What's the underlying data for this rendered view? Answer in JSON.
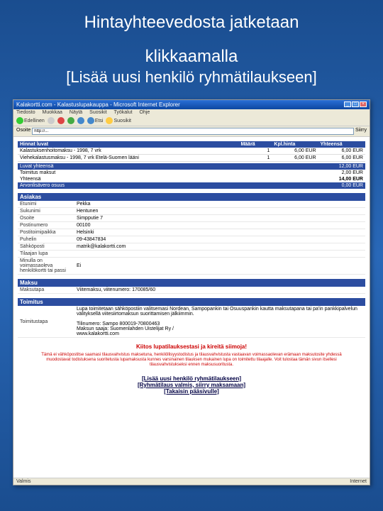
{
  "slide": {
    "title_a": "Hintayhteevedosta jatketaan",
    "title_b": "klikkaamalla",
    "subtitle": "[Lisää uusi henkilö ryhmätilaukseen]"
  },
  "window": {
    "title": "Kalakortti.com - Kalastuslupakauppa - Microsoft Internet Explorer",
    "menu": [
      "Tiedosto",
      "Muokkaa",
      "Näytä",
      "Suosikit",
      "Työkalut",
      "Ohje"
    ],
    "toolbar": {
      "back": "Edellinen",
      "search": "Etsi",
      "fav": "Suosikit"
    },
    "addr_label": "Osoite",
    "addr": "http://...",
    "go": "Siirry",
    "status": "Valmis",
    "zone": "Internet"
  },
  "price_headers": {
    "name": "Hinnat luvat",
    "qty": "Määrä",
    "unit": "Kpl.hinta",
    "total": "Yhteensä"
  },
  "price_rows": [
    {
      "name": "Kalastuksenhoitomaksu - 1998, 7 vrk",
      "qty": "1",
      "unit": "6,00 EUR",
      "total": "6,00 EUR"
    },
    {
      "name": "Viehekalastusmaksu - 1998, 7 vrk Etelä-Suomen lääni",
      "qty": "1",
      "unit": "6,00 EUR",
      "total": "6,00 EUR"
    }
  ],
  "totals": {
    "sub_l": "Luvat yhteensä",
    "sub_v": "12,00 EUR",
    "ship_l": "Toimitus maksut",
    "ship_v": "2,00 EUR",
    "tot_l": "Yhteensä",
    "tot_v": "14,00 EUR",
    "vat_l": "Arvonlisävero osuus",
    "vat_v": "0,00 EUR"
  },
  "sections": {
    "customer": "Asiakas",
    "payment": "Maksu",
    "delivery": "Toimitus"
  },
  "customer": [
    {
      "l": "Etunimi",
      "v": "Pekka"
    },
    {
      "l": "Sukunimi",
      "v": "Hentunen"
    },
    {
      "l": "Osoite",
      "v": "Simpputie 7"
    },
    {
      "l": "Postinumero",
      "v": "00100"
    },
    {
      "l": "Postitoimipaikka",
      "v": "Helsinki"
    },
    {
      "l": "Puhelin",
      "v": "09-43847834"
    },
    {
      "l": "Sähköposti",
      "v": "matrik@kalakortti.com"
    },
    {
      "l": "Tilaajan lupa",
      "v": ""
    },
    {
      "l": "Minulla on voimassaoleva henkilökortti tai passi",
      "v": "Ei"
    }
  ],
  "payment": [
    {
      "l": "Maksutapa",
      "v": "Viitemaksu, viitenumero: 170085/60"
    }
  ],
  "delivery": [
    {
      "l": "Toimitustapa",
      "v": "Lupa toimitetaan sähköpostiin valitsemasi Nordean, Sampopankin tai Osuuspankin kautta maksutapana tai pa'in pankkipalvelun välityksellä viitesiirtomaksun suorittamisen jälkiimmin.\n\nTilinumero: Sampo 800019-70800463\nMaksun saaja: Suomenlahden Uistelijat Ry /\nwww.kalakortti.com"
    }
  ],
  "thanks": "Kiitos lupatilauksestasi ja kireitä siimoja!",
  "note": "Tämä ei vähköpostitse saamasi tilausvahvistus maksetuna, henkilöllisyystodistus ja tilausvahvistusta vastaavan voimassaolevan erämaan maksutosite yhdessä muodostavat todistuksena suoritetusta lupamaksusta kunnes varsinainen tilauksen mukainen lupa on toimitettu tilaajalle. Voit tulostaa tämän sivun itsellesi tilausvahvistukseksi ennen maksusuoritusta.",
  "actions": {
    "a": "[Lisää uusi henkilö ryhmätilaukseen]",
    "b": "[Ryhmätilaus valmis, siirry maksamaan]",
    "c": "[Takaisin pääsivulle]"
  }
}
